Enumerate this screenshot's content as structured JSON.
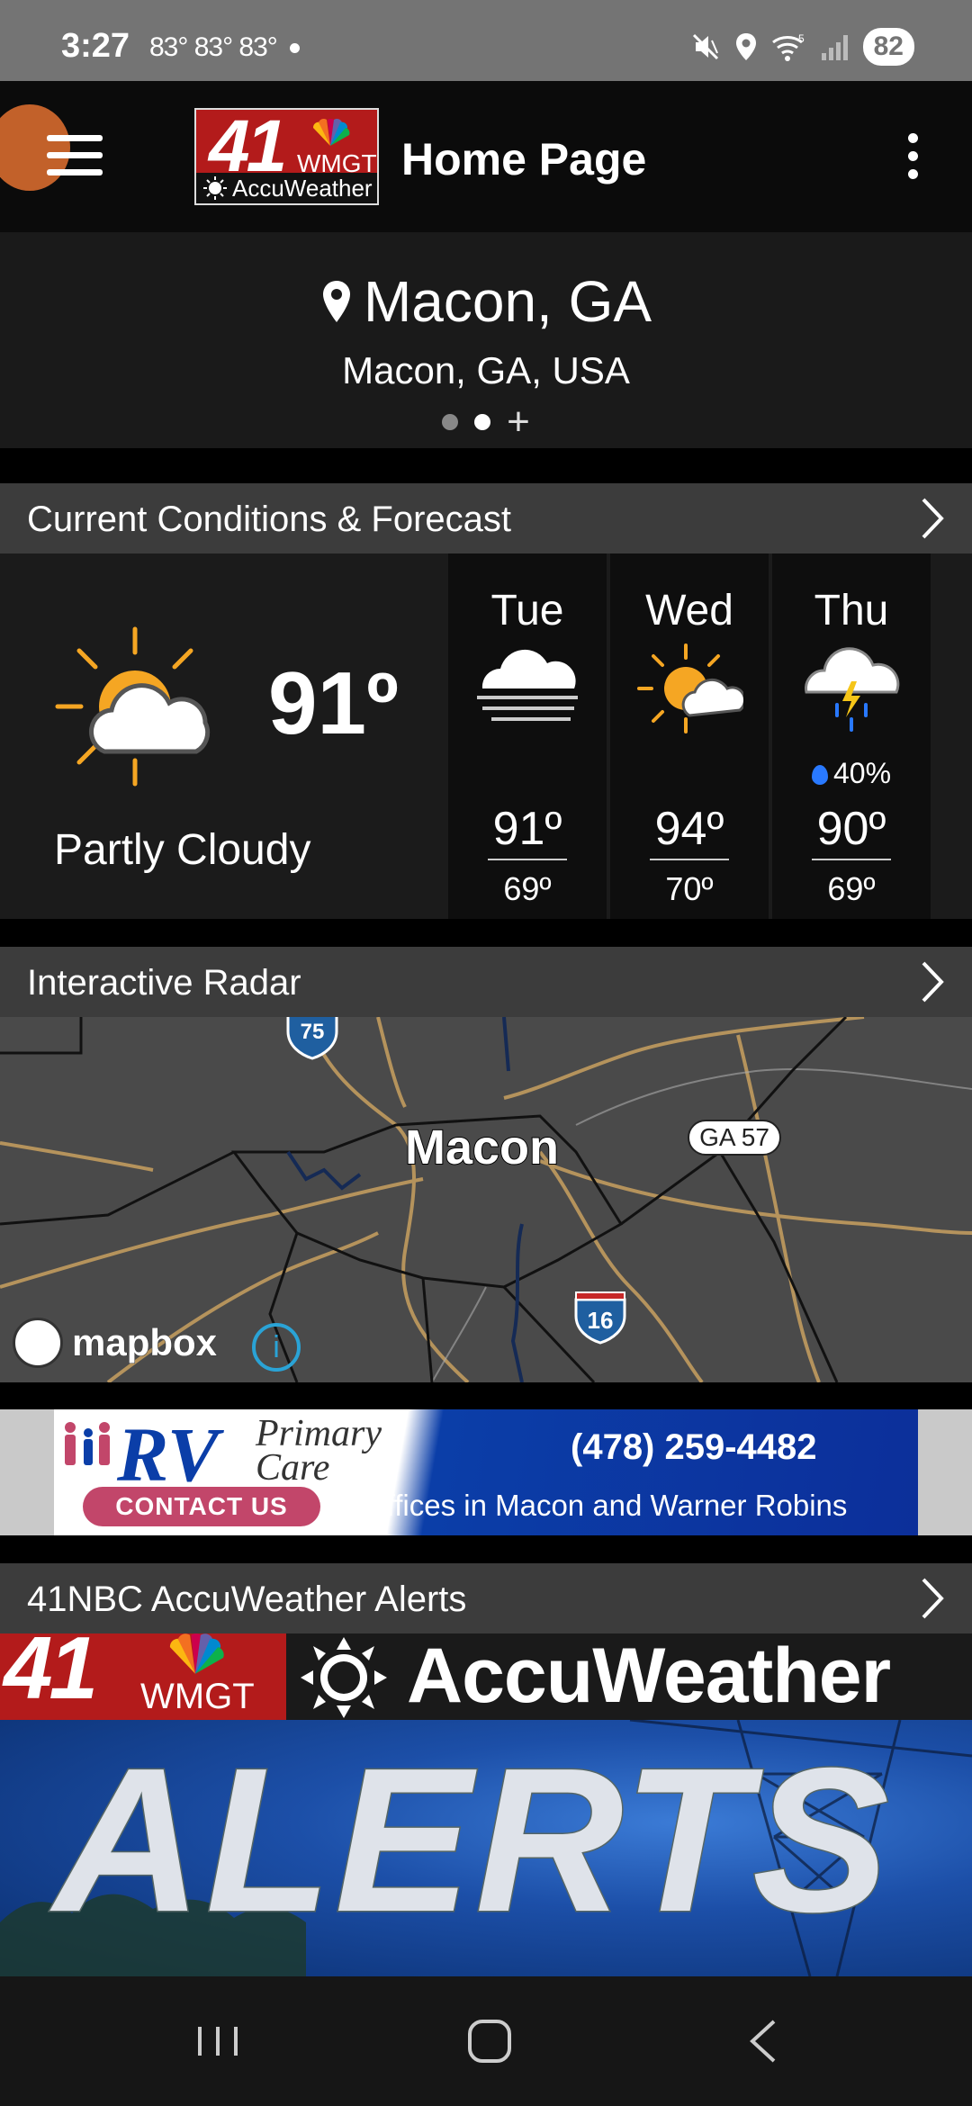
{
  "status_bar": {
    "time": "3:27",
    "temps": "83° 83° 83°",
    "battery": "82"
  },
  "app_bar": {
    "logo_number": "41",
    "logo_station": "WMGT",
    "logo_brand": "AccuWeather",
    "title": "Home Page"
  },
  "location": {
    "city": "Macon, GA",
    "full": "Macon, GA, USA"
  },
  "conditions": {
    "header": "Current Conditions & Forecast",
    "current_temp": "91º",
    "current_desc": "Partly Cloudy",
    "icon": "partly-cloudy-icon",
    "forecast": [
      {
        "day": "Tue",
        "icon": "fog-icon",
        "precip": "",
        "hi": "91º",
        "lo": "69º"
      },
      {
        "day": "Wed",
        "icon": "mostly-sunny-icon",
        "precip": "",
        "hi": "94º",
        "lo": "70º"
      },
      {
        "day": "Thu",
        "icon": "thunderstorm-icon",
        "precip": "40%",
        "hi": "90º",
        "lo": "69º"
      }
    ]
  },
  "radar": {
    "header": "Interactive Radar",
    "city_label": "Macon",
    "road_ga": "GA 57",
    "road_i16": "16",
    "road_i75": "75",
    "attribution": "mapbox"
  },
  "ad": {
    "brand": "RV",
    "tagline": "Primary Care",
    "cta": "CONTACT US",
    "phone": "(478) 259-4482",
    "offices": "Offices in Macon and Warner Robins"
  },
  "alerts": {
    "header": "41NBC AccuWeather Alerts",
    "banner_number": "41",
    "banner_station": "WMGT",
    "banner_brand": "AccuWeather",
    "banner_title": "ALERTS"
  },
  "colors": {
    "nbc_red": "#b31b1b",
    "section_header": "#3c3c3c",
    "sun_orange": "#f5a623",
    "ad_blue": "#0b3ea8"
  }
}
